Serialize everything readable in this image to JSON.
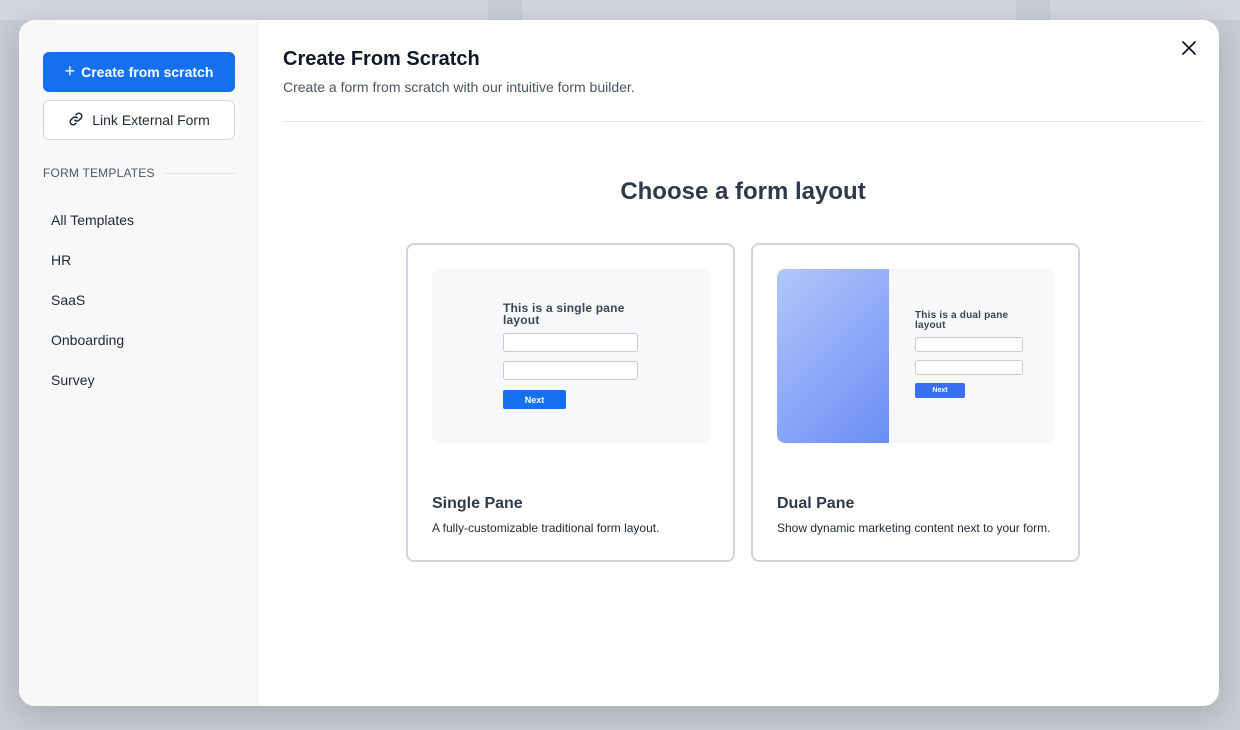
{
  "sidebar": {
    "create_label": "Create from scratch",
    "link_label": "Link External Form",
    "section_heading": "FORM TEMPLATES",
    "items": [
      {
        "label": "All Templates"
      },
      {
        "label": "HR"
      },
      {
        "label": "SaaS"
      },
      {
        "label": "Onboarding"
      },
      {
        "label": "Survey"
      }
    ]
  },
  "header": {
    "title": "Create From Scratch",
    "subtitle": "Create a form from scratch with our intuitive form builder."
  },
  "main": {
    "layout_heading": "Choose a form layout",
    "cards": [
      {
        "preview_heading": "This is a single pane layout",
        "preview_button": "Next",
        "title": "Single Pane",
        "description": "A fully-customizable traditional form layout."
      },
      {
        "preview_heading": "This is a dual pane layout",
        "preview_button": "Next",
        "title": "Dual Pane",
        "description": "Show dynamic marketing content next to your form."
      }
    ]
  },
  "colors": {
    "accent": "#1570ef",
    "sidebar_bg": "#f8f8f9",
    "backdrop": "#c8ccd3",
    "gradient_start": "#b2c7fb",
    "gradient_end": "#6b8df5"
  },
  "icons": {
    "create": "plus-icon",
    "link": "link-icon",
    "close": "close-icon"
  }
}
